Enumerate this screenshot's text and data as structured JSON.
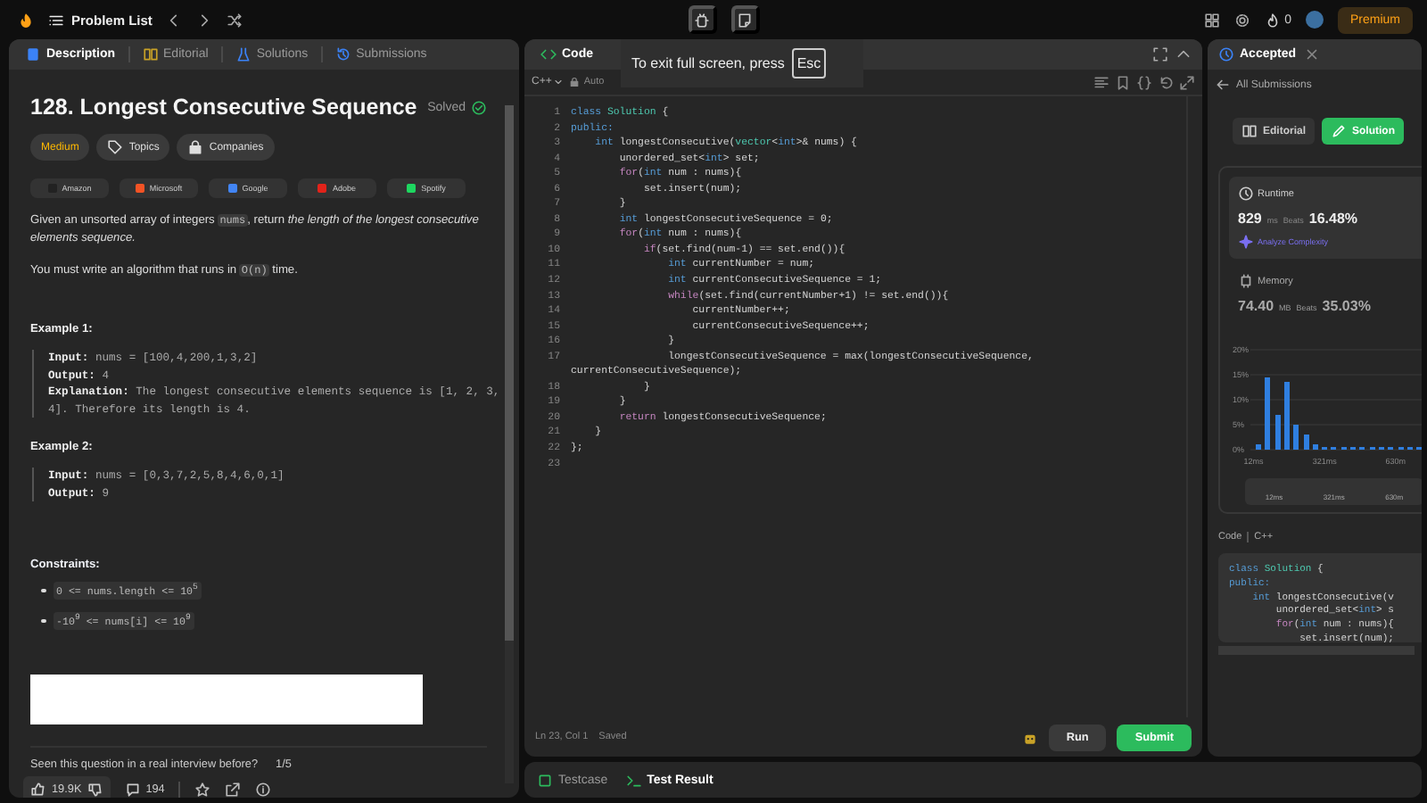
{
  "top_bar": {
    "title": "Problem List",
    "streak": "0",
    "premium": "Premium"
  },
  "description_panel": {
    "tabs": [
      {
        "label": "Description",
        "selected": true
      },
      {
        "label": "Editorial",
        "selected": false
      },
      {
        "label": "Solutions",
        "selected": false
      },
      {
        "label": "Submissions",
        "selected": false
      }
    ],
    "title": "128. Longest Consecutive Sequence",
    "status": "Solved",
    "tags": [
      {
        "label": "Medium",
        "kind": "difficulty"
      },
      {
        "label": "Topics",
        "kind": "topics"
      },
      {
        "label": "Companies",
        "kind": "companies"
      }
    ],
    "companies": [
      "Amazon",
      "Microsoft",
      "Google",
      "Adobe",
      "Spotify"
    ],
    "paragraphs": [
      [
        {
          "text": "Given an unsorted array of integers ",
          "kind": "text"
        },
        {
          "text": "nums",
          "kind": "code"
        },
        {
          "text": ", return ",
          "kind": "text"
        },
        {
          "text": "the length of the longest consecutive elements sequence.",
          "kind": "italic"
        }
      ],
      [
        {
          "text": "You must write an algorithm that runs in ",
          "kind": "text"
        },
        {
          "text": "O(n)",
          "kind": "code"
        },
        {
          "text": " time.",
          "kind": "text"
        }
      ]
    ],
    "examples": [
      {
        "heading": "Example 1:",
        "lines": [
          {
            "label": "Input:",
            "text": "nums = [100,4,200,1,3,2]"
          },
          {
            "label": "Output:",
            "text": "4"
          },
          {
            "label": "Explanation:",
            "text": "The longest consecutive elements sequence is [1, 2, 3, 4]. Therefore its length is 4."
          }
        ]
      },
      {
        "heading": "Example 2:",
        "lines": [
          {
            "label": "Input:",
            "text": "nums = [0,3,7,2,5,8,4,6,0,1]"
          },
          {
            "label": "Output:",
            "text": "9"
          }
        ]
      }
    ],
    "constraints_heading": "Constraints:",
    "constraints": [
      "0 <= nums.length <= 10$^{5}$",
      "-10$^{9}$ <= nums[i] <= 10$^{9}$"
    ],
    "interview_question": "Seen this question in a real interview before?",
    "interview_count": "1/5",
    "likes": "19.9K",
    "comments": "194"
  },
  "code_panel": {
    "title": "Code",
    "toast": "To exit full screen, press",
    "toast_key": "Esc",
    "language": "C++",
    "mode": "Auto",
    "lines": [
      {
        "number": "1",
        "tokens": [
          {
            "text": "class ",
            "kind": "keyword"
          },
          {
            "text": "Solution",
            "kind": "type"
          },
          {
            "text": " {",
            "kind": "text"
          }
        ]
      },
      {
        "number": "2",
        "tokens": [
          {
            "text": "public:",
            "kind": "keyword"
          }
        ]
      },
      {
        "number": "3",
        "tokens": [
          {
            "text": "    int",
            "kind": "keyword"
          },
          {
            "text": " longestConsecutive(",
            "kind": "text"
          },
          {
            "text": "vector",
            "kind": "type"
          },
          {
            "text": "<",
            "kind": "text"
          },
          {
            "text": "int",
            "kind": "keyword"
          },
          {
            "text": ">& nums) {",
            "kind": "text"
          }
        ]
      },
      {
        "number": "4",
        "tokens": [
          {
            "text": "        unordered_set<",
            "kind": "text"
          },
          {
            "text": "int",
            "kind": "keyword"
          },
          {
            "text": "> set;",
            "kind": "text"
          }
        ]
      },
      {
        "number": "5",
        "tokens": [
          {
            "text": "        for",
            "kind": "control"
          },
          {
            "text": "(",
            "kind": "text"
          },
          {
            "text": "int",
            "kind": "keyword"
          },
          {
            "text": " num : nums){",
            "kind": "text"
          }
        ]
      },
      {
        "number": "6",
        "tokens": [
          {
            "text": "            set.insert(num);",
            "kind": "text"
          }
        ]
      },
      {
        "number": "7",
        "tokens": [
          {
            "text": "        }",
            "kind": "text"
          }
        ]
      },
      {
        "number": "8",
        "tokens": [
          {
            "text": "        int",
            "kind": "keyword"
          },
          {
            "text": " longestConsecutiveSequence = 0;",
            "kind": "text"
          }
        ]
      },
      {
        "number": "9",
        "tokens": [
          {
            "text": "        for",
            "kind": "control"
          },
          {
            "text": "(",
            "kind": "text"
          },
          {
            "text": "int",
            "kind": "keyword"
          },
          {
            "text": " num : nums){",
            "kind": "text"
          }
        ]
      },
      {
        "number": "10",
        "tokens": [
          {
            "text": "            if",
            "kind": "control"
          },
          {
            "text": "(set.find(num-1) == set.end()){",
            "kind": "text"
          }
        ]
      },
      {
        "number": "11",
        "tokens": [
          {
            "text": "                int",
            "kind": "keyword"
          },
          {
            "text": " currentNumber = num;",
            "kind": "text"
          }
        ]
      },
      {
        "number": "12",
        "tokens": [
          {
            "text": "                int",
            "kind": "keyword"
          },
          {
            "text": " currentConsecutiveSequence = 1;",
            "kind": "text"
          }
        ]
      },
      {
        "number": "13",
        "tokens": [
          {
            "text": "                while",
            "kind": "control"
          },
          {
            "text": "(set.find(currentNumber+1) != set.end()){",
            "kind": "text"
          }
        ]
      },
      {
        "number": "14",
        "tokens": [
          {
            "text": "                    currentNumber++;",
            "kind": "text"
          }
        ]
      },
      {
        "number": "15",
        "tokens": [
          {
            "text": "                    currentConsecutiveSequence++;",
            "kind": "text"
          }
        ]
      },
      {
        "number": "16",
        "tokens": [
          {
            "text": "                }",
            "kind": "text"
          }
        ]
      },
      {
        "number": "17",
        "tokens": [
          {
            "text": "                longestConsecutiveSequence = max(longestConsecutiveSequence, currentConsecutiveSequence);",
            "kind": "text"
          }
        ]
      },
      {
        "number": "18",
        "tokens": [
          {
            "text": "            }",
            "kind": "text"
          }
        ]
      },
      {
        "number": "19",
        "tokens": [
          {
            "text": "        }",
            "kind": "text"
          }
        ]
      },
      {
        "number": "20",
        "tokens": [
          {
            "text": "        return",
            "kind": "control"
          },
          {
            "text": " longestConsecutiveSequence;",
            "kind": "text"
          }
        ]
      },
      {
        "number": "21",
        "tokens": [
          {
            "text": "    }",
            "kind": "text"
          }
        ]
      },
      {
        "number": "22",
        "tokens": [
          {
            "text": "};",
            "kind": "text"
          }
        ]
      },
      {
        "number": "23"
      }
    ],
    "cursor": "Ln 23, Col 1",
    "save_state": "Saved",
    "buttons": [
      {
        "label": "Run",
        "kind": "secondary"
      },
      {
        "label": "Submit",
        "kind": "primary"
      }
    ]
  },
  "result_panel": {
    "tab": "Accepted",
    "back_link": "All Submissions",
    "buttons": [
      {
        "label": "Editorial",
        "kind": "secondary"
      },
      {
        "label": "Solution",
        "kind": "primary"
      }
    ],
    "runtime": {
      "label": "Runtime",
      "value": "829",
      "unit": "ms",
      "beats_label": "Beats",
      "beats": "16.48%",
      "link": "Analyze Complexity"
    },
    "memory": {
      "label": "Memory",
      "value": "74.40",
      "unit": "MB",
      "beats_label": "Beats",
      "beats": "35.03%"
    },
    "chart_data": {
      "type": "bar",
      "x": [
        32.6,
        73.8,
        115,
        156.2,
        197.4,
        238.6,
        279.8,
        321,
        362.2,
        403.4,
        444.6,
        485.8,
        527,
        568.2,
        609.4,
        650.6,
        691.8,
        733
      ],
      "xlim": [
        -2,
        743
      ],
      "values": [
        1,
        14.5,
        7,
        13.5,
        5,
        3,
        1,
        0.5,
        0.5,
        0.5,
        0.5,
        0.5,
        0.5,
        0.5,
        0.5,
        0.5,
        0.5,
        0.5
      ],
      "ylim": [
        0,
        20
      ],
      "grid": true,
      "yticks": [
        {
          "value": 0,
          "label": "0%"
        },
        {
          "value": 5,
          "label": "5%"
        },
        {
          "value": 10,
          "label": "10%"
        },
        {
          "value": 15,
          "label": "15%"
        },
        {
          "value": 20,
          "label": "20%"
        }
      ],
      "xticks": [
        {
          "value": 12,
          "label": "12ms"
        },
        {
          "value": 321,
          "label": "321ms"
        },
        {
          "value": 630,
          "label": "630m"
        }
      ]
    },
    "range_labels": [
      "12ms",
      "321ms",
      "630m"
    ],
    "code_label": "Code",
    "code_language": "C++",
    "code_lines": [
      {
        "tokens": [
          {
            "text": "class ",
            "kind": "keyword"
          },
          {
            "text": "Solution",
            "kind": "type"
          },
          {
            "text": " {",
            "kind": "text"
          }
        ]
      },
      {
        "tokens": [
          {
            "text": "public:",
            "kind": "keyword"
          }
        ]
      },
      {
        "tokens": [
          {
            "text": "    int",
            "kind": "keyword"
          },
          {
            "text": " longestConsecutive(v",
            "kind": "text"
          }
        ]
      },
      {
        "tokens": [
          {
            "text": "        unordered_set<",
            "kind": "text"
          },
          {
            "text": "int",
            "kind": "keyword"
          },
          {
            "text": "> s",
            "kind": "text"
          }
        ]
      },
      {
        "tokens": [
          {
            "text": "        for",
            "kind": "control"
          },
          {
            "text": "(",
            "kind": "text"
          },
          {
            "text": "int",
            "kind": "keyword"
          },
          {
            "text": " num : nums){",
            "kind": "text"
          }
        ]
      },
      {
        "tokens": [
          {
            "text": "            set.insert(num);",
            "kind": "text"
          }
        ]
      }
    ]
  },
  "bottom_panel": {
    "tabs": [
      {
        "label": "Testcase",
        "selected": false
      },
      {
        "label": "Test Result",
        "selected": true
      }
    ]
  }
}
